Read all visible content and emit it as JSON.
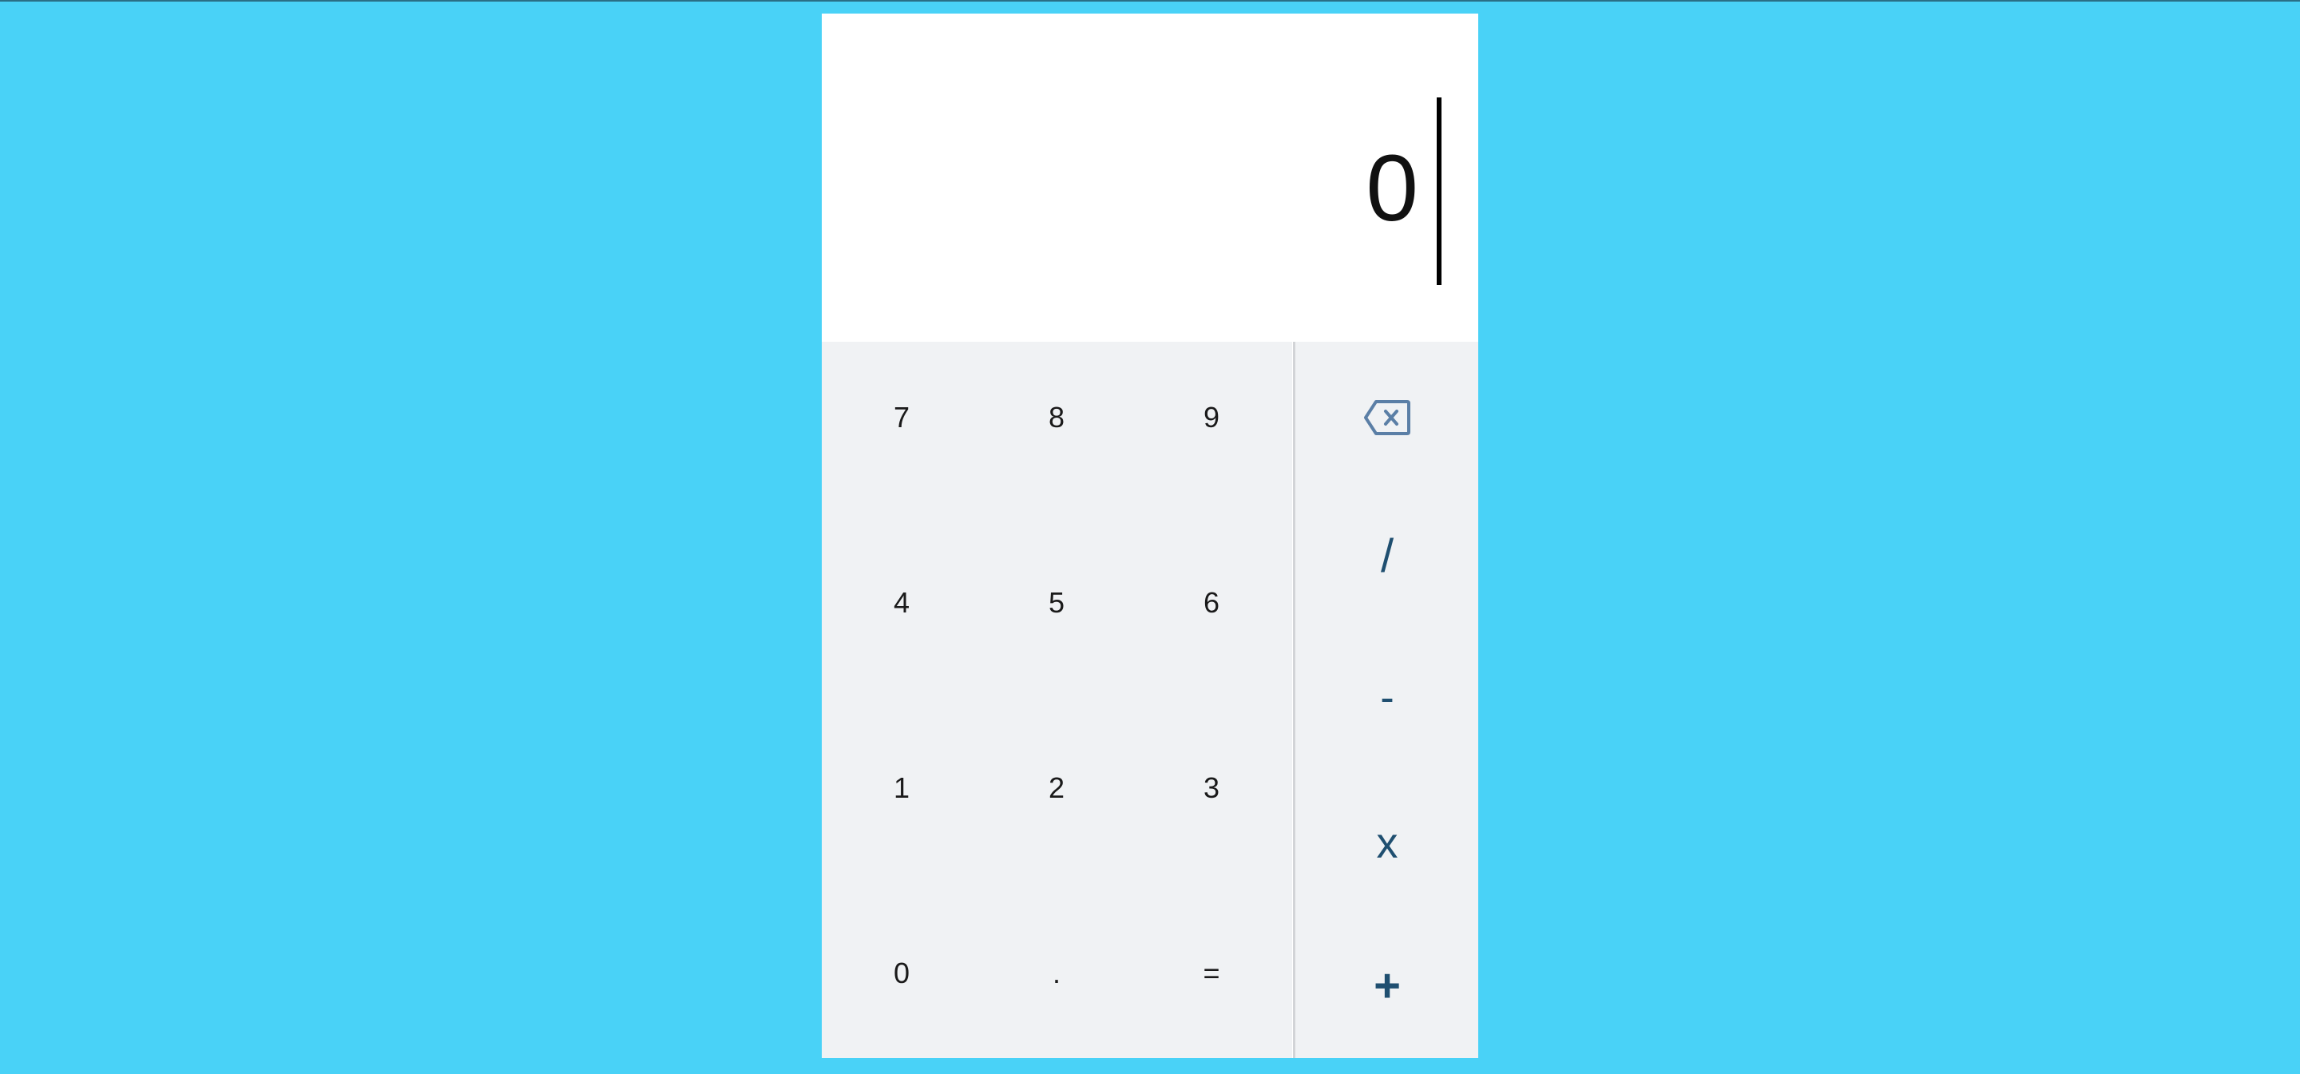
{
  "display": {
    "value": "0"
  },
  "keypad": {
    "rows": [
      [
        "7",
        "8",
        "9"
      ],
      [
        "4",
        "5",
        "6"
      ],
      [
        "1",
        "2",
        "3"
      ],
      [
        "0",
        ".",
        "="
      ]
    ]
  },
  "operators": {
    "backspace_icon": "backspace-icon",
    "divide": "/",
    "subtract": "-",
    "multiply": "x",
    "add": "+"
  },
  "colors": {
    "background": "#49d2f7",
    "display": "#ffffff",
    "keypad": "#f0f2f4",
    "operator_text": "#1f4f70",
    "backspace_icon": "#5b7fa6"
  }
}
